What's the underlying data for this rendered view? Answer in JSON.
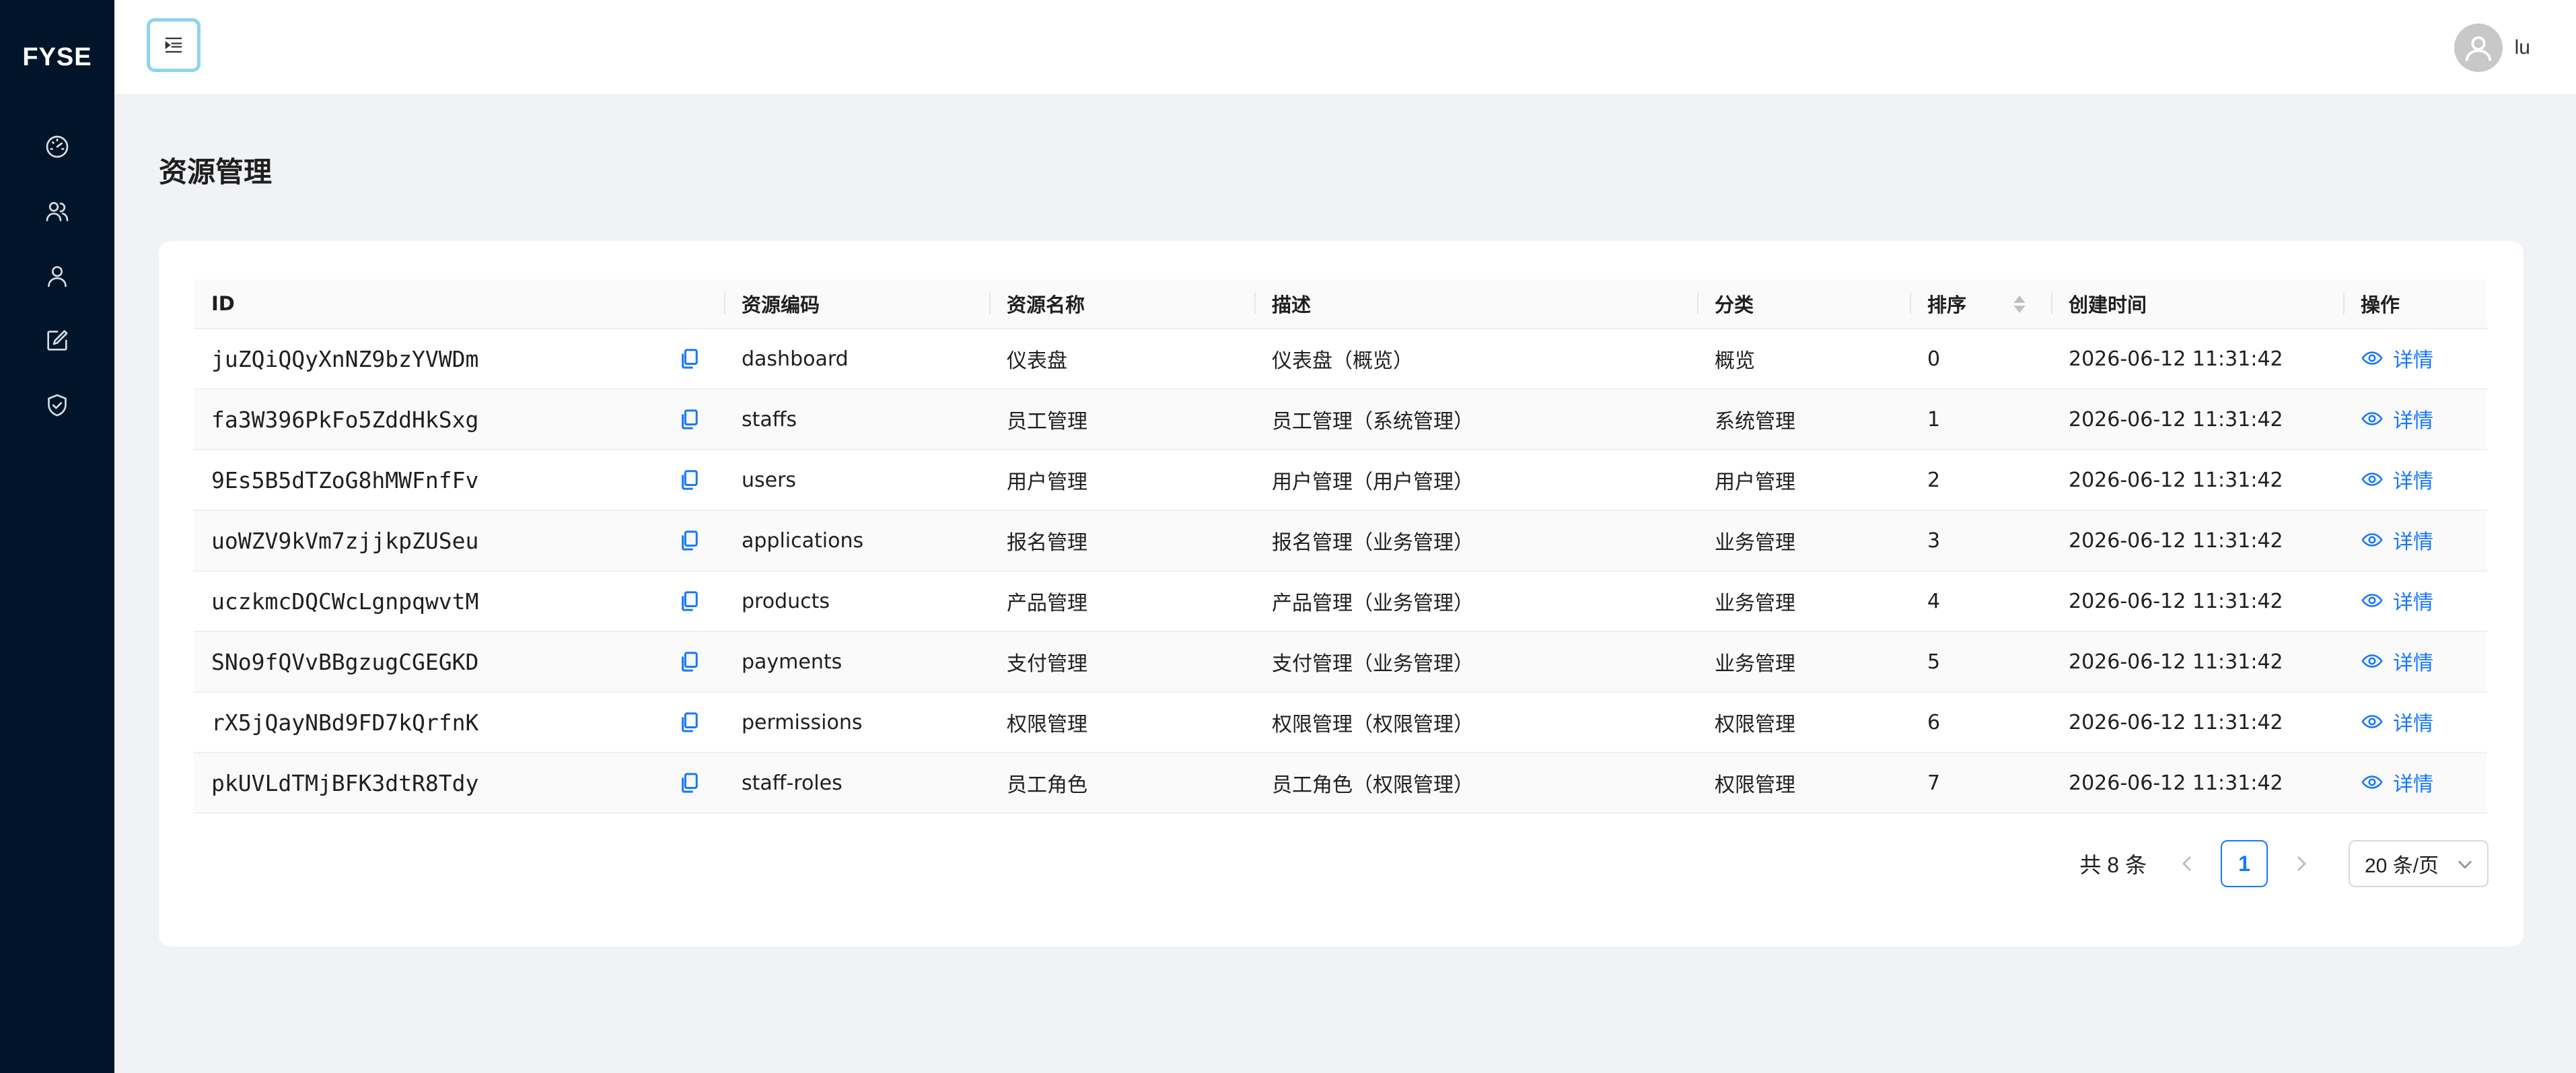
{
  "app": {
    "logo": "FYSE"
  },
  "sidebar": {
    "items": [
      {
        "icon": "dashboard-icon"
      },
      {
        "icon": "staff-icon"
      },
      {
        "icon": "user-icon"
      },
      {
        "icon": "edit-icon"
      },
      {
        "icon": "shield-check-icon"
      }
    ]
  },
  "header": {
    "username": "lu"
  },
  "page": {
    "title": "资源管理"
  },
  "table": {
    "columns": {
      "id": "ID",
      "code": "资源编码",
      "name": "资源名称",
      "description": "描述",
      "category": "分类",
      "order": "排序",
      "created": "创建时间",
      "action": "操作"
    },
    "action_label": "详情",
    "rows": [
      {
        "id": "juZQiQQyXnNZ9bzYVWDm",
        "code": "dashboard",
        "name": "仪表盘",
        "description": "仪表盘（概览）",
        "category": "概览",
        "order": "0",
        "created": "2026-06-12 11:31:42"
      },
      {
        "id": "fa3W396PkFo5ZddHkSxg",
        "code": "staffs",
        "name": "员工管理",
        "description": "员工管理（系统管理）",
        "category": "系统管理",
        "order": "1",
        "created": "2026-06-12 11:31:42"
      },
      {
        "id": "9Es5B5dTZoG8hMWFnfFv",
        "code": "users",
        "name": "用户管理",
        "description": "用户管理（用户管理）",
        "category": "用户管理",
        "order": "2",
        "created": "2026-06-12 11:31:42"
      },
      {
        "id": "uoWZV9kVm7zjjkpZUSeu",
        "code": "applications",
        "name": "报名管理",
        "description": "报名管理（业务管理）",
        "category": "业务管理",
        "order": "3",
        "created": "2026-06-12 11:31:42"
      },
      {
        "id": "uczkmcDQCWcLgnpqwvtM",
        "code": "products",
        "name": "产品管理",
        "description": "产品管理（业务管理）",
        "category": "业务管理",
        "order": "4",
        "created": "2026-06-12 11:31:42"
      },
      {
        "id": "SNo9fQVvBBgzugCGEGKD",
        "code": "payments",
        "name": "支付管理",
        "description": "支付管理（业务管理）",
        "category": "业务管理",
        "order": "5",
        "created": "2026-06-12 11:31:42"
      },
      {
        "id": "rX5jQayNBd9FD7kQrfnK",
        "code": "permissions",
        "name": "权限管理",
        "description": "权限管理（权限管理）",
        "category": "权限管理",
        "order": "6",
        "created": "2026-06-12 11:31:42"
      },
      {
        "id": "pkUVLdTMjBFK3dtR8Tdy",
        "code": "staff-roles",
        "name": "员工角色",
        "description": "员工角色（权限管理）",
        "category": "权限管理",
        "order": "7",
        "created": "2026-06-12 11:31:42"
      }
    ]
  },
  "pagination": {
    "total_label": "共 8 条",
    "current_page": "1",
    "page_size_label": "20 条/页"
  },
  "colors": {
    "sidebar_bg": "#001529",
    "accent": "#1677ff",
    "page_bg": "#f0f2f5"
  }
}
